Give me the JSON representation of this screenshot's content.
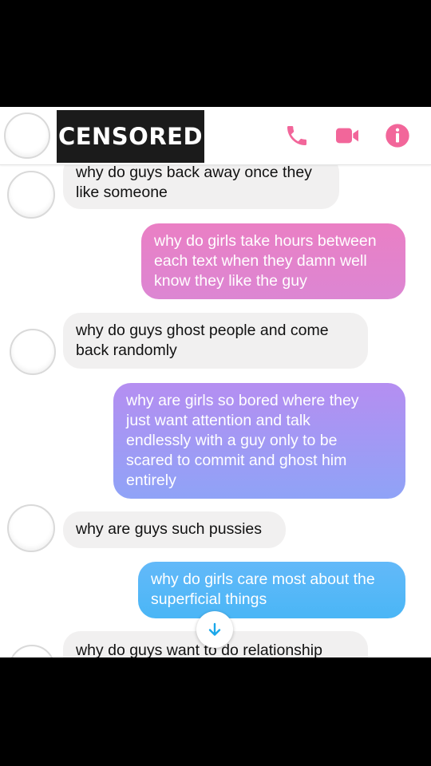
{
  "header": {
    "censor_label": "CENSORED",
    "icons": [
      "phone-icon",
      "video-camera-icon",
      "info-icon"
    ],
    "accent_color": "#f2669a"
  },
  "messages": [
    {
      "sender": "them",
      "text": "why do guys back away once they\nlike someone"
    },
    {
      "sender": "me",
      "text": "why do girls take hours between\neach text when they damn well\nknow they like the guy"
    },
    {
      "sender": "them",
      "text": "why do guys ghost people and come\nback randomly"
    },
    {
      "sender": "me",
      "text": "why are girls so bored where they\njust want attention and talk\nendlessly with a guy only to be\nscared to commit and ghost him\nentirely"
    },
    {
      "sender": "them",
      "text": "why are guys such pussies"
    },
    {
      "sender": "me",
      "text": "why do girls care most about the\nsuperficial things"
    },
    {
      "sender": "them",
      "text": "why do guys want to do relationship"
    }
  ],
  "scroll_button": {
    "icon": "arrow-down-icon",
    "color": "#19a7ea"
  }
}
